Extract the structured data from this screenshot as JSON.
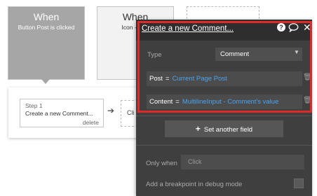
{
  "events": [
    {
      "title": "When",
      "subtitle": "Button Post is clicked"
    },
    {
      "title": "When",
      "subtitle": "Icon - Like"
    }
  ],
  "steps": {
    "step1_number": "Step 1",
    "step1_name": "Create a new Comment...",
    "step1_delete": "delete",
    "add_step_label": "Cli"
  },
  "panel": {
    "title": "Create a new Comment...",
    "help_glyph": "?",
    "type_label": "Type",
    "type_value": "Comment",
    "fields": [
      {
        "key": "Post",
        "eq": "=",
        "value": "Current Page Post"
      },
      {
        "key": "Content",
        "eq": "=",
        "value": "MultilineInput - Comment's value"
      }
    ],
    "set_field_label": "Set another field",
    "only_when_label": "Only when",
    "only_when_placeholder": "Click",
    "breakpoint_label": "Add a breakpoint in debug mode"
  },
  "colors": {
    "highlight": "#e02a2a",
    "value_text": "#4aa3ef",
    "panel_bg": "#3f3f3f"
  },
  "icons": [
    "help-icon",
    "comment-icon",
    "close-icon",
    "trash-icon",
    "arrow-right-icon",
    "chevron-down-icon",
    "plus-icon"
  ]
}
